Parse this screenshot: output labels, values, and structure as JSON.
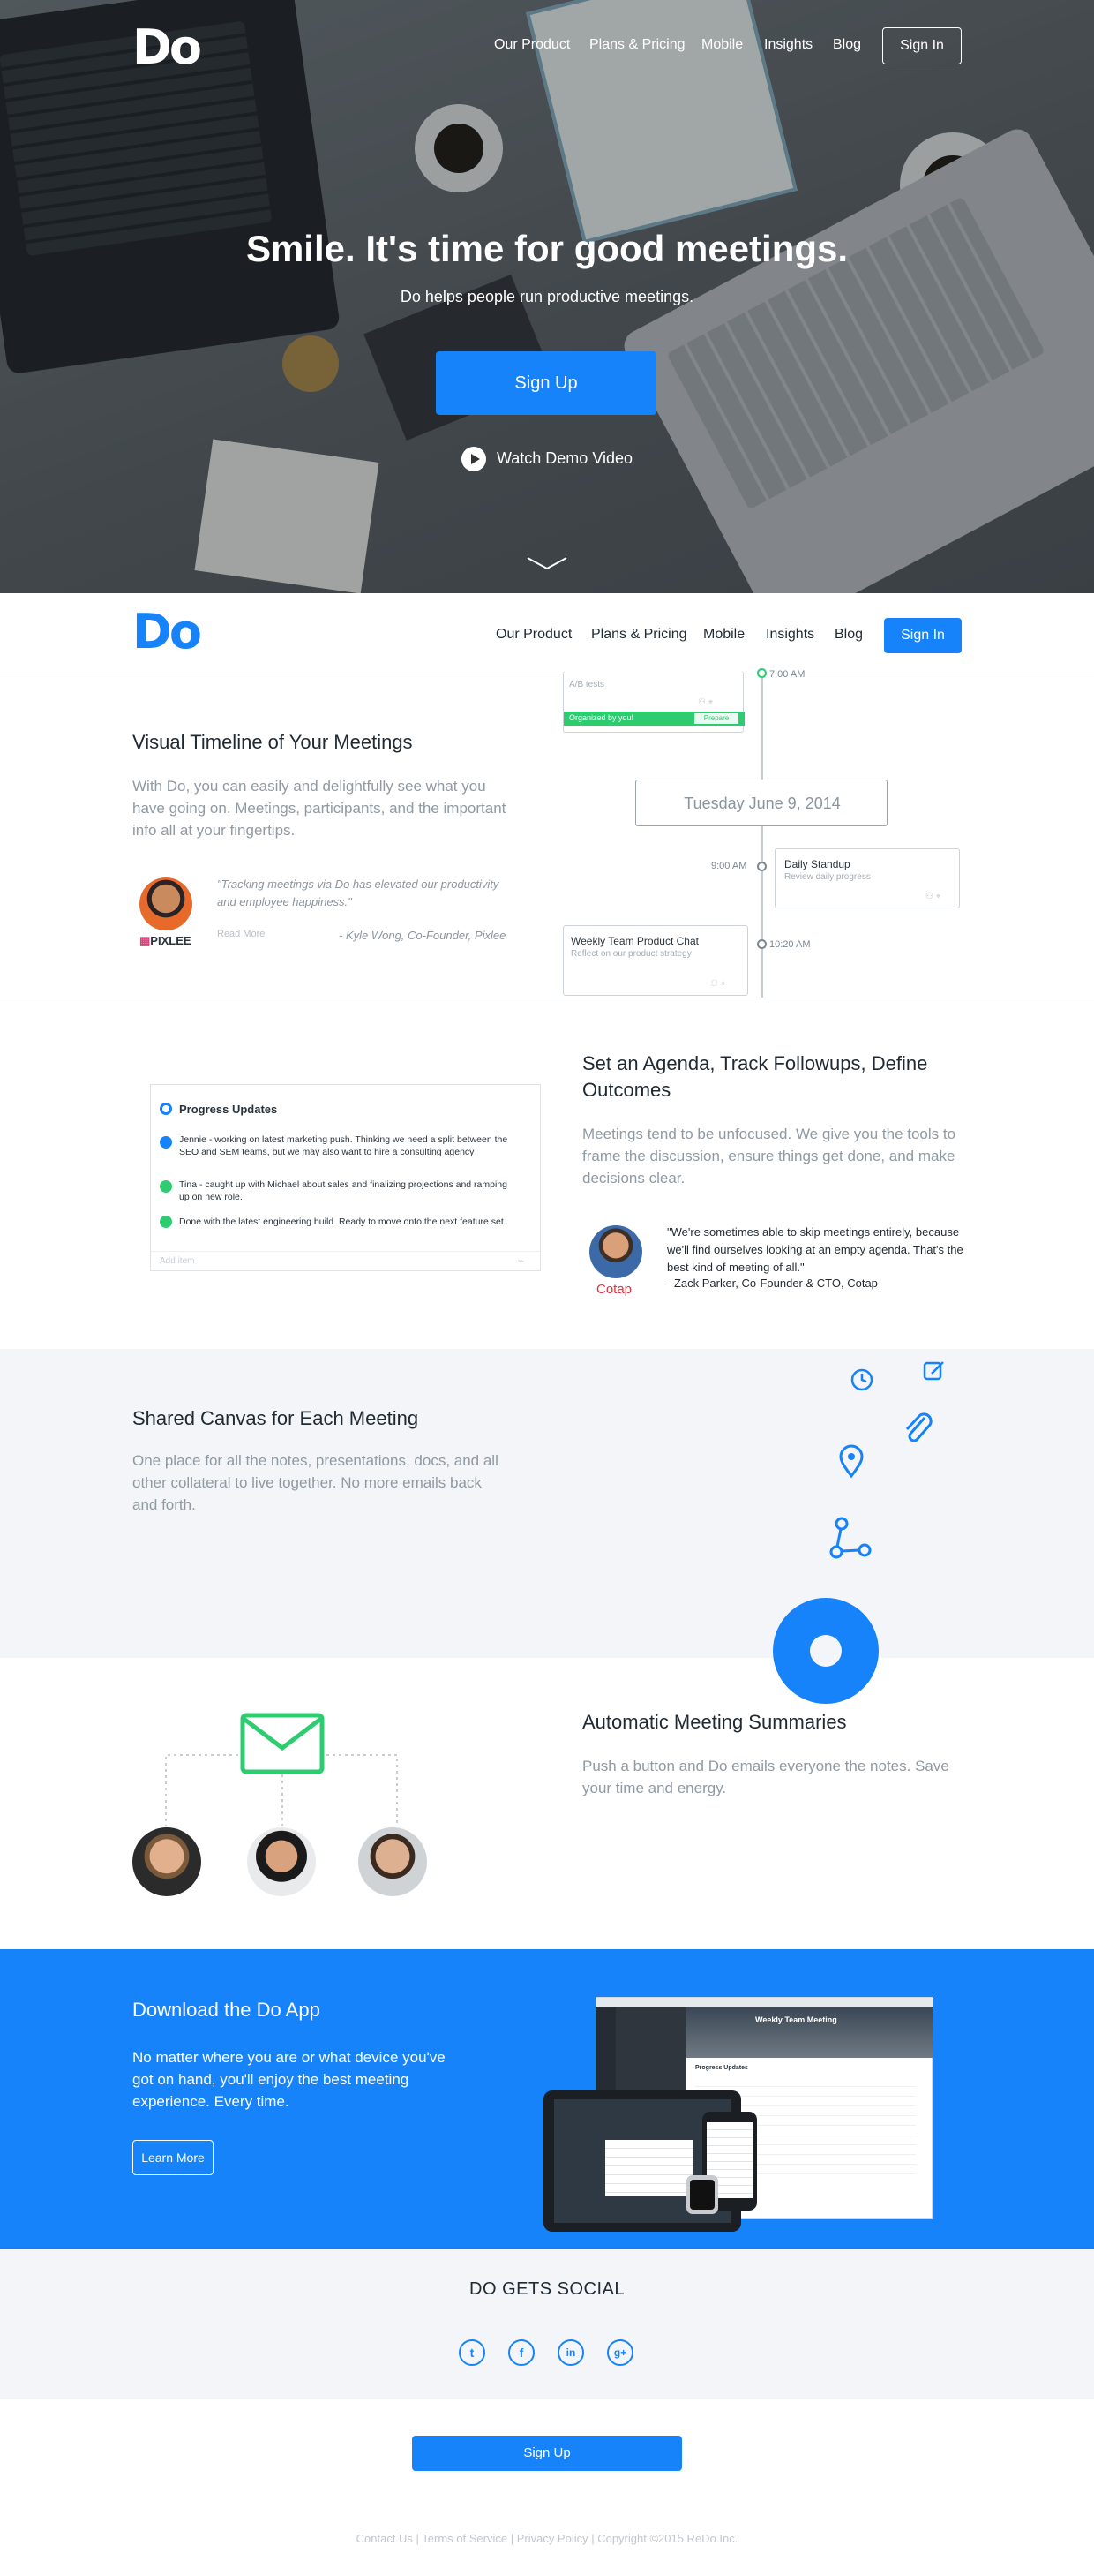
{
  "hero": {
    "logo": "Do",
    "nav": [
      "Our Product",
      "Plans & Pricing",
      "Mobile",
      "Insights",
      "Blog"
    ],
    "signin": "Sign In",
    "title": "Smile. It's time for good meetings.",
    "subtitle": "Do helps people run productive meetings.",
    "signup": "Sign Up",
    "demo": "Watch Demo Video"
  },
  "sticky_nav": {
    "logo": "Do",
    "nav": [
      "Our Product",
      "Plans & Pricing",
      "Mobile",
      "Insights",
      "Blog"
    ],
    "signin": "Sign In"
  },
  "timeline_section": {
    "title": "Visual Timeline of Your Meetings",
    "body": "With Do, you can easily and delightfully see what you have going on. Meetings, participants, and the important info all at your fingertips.",
    "quote": "\"Tracking meetings via Do has elevated our productivity and employee happiness.\"",
    "read_more": "Read More",
    "attribution": "- Kyle Wong, Co-Founder, Pixlee",
    "company_logo": "PIXLEE",
    "top_card_sub": "A/B tests",
    "organized": "Organized by you!",
    "prepare": "Prepare",
    "date": "Tuesday June 9, 2014",
    "time1": "9:00 AM",
    "card1_title": "Daily Standup",
    "card1_sub": "Review daily progress",
    "time2": "10:20 AM",
    "card2_title": "Weekly Team Product Chat",
    "card2_sub": "Reflect on our product strategy",
    "time0": "7:00 AM"
  },
  "agenda_section": {
    "title": "Set an Agenda, Track Followups, Define Outcomes",
    "body": "Meetings tend to be unfocused. We give you the tools to frame the discussion, ensure things get done, and make decisions clear.",
    "quote": "\"We're sometimes able to skip meetings entirely, because we'll find ourselves looking at an empty agenda. That's the best kind of meeting of all.\"",
    "attribution": "- Zack Parker, Co-Founder & CTO, Cotap",
    "company_logo": "Cotap",
    "card_title": "Progress Updates",
    "items": [
      "Jennie - working on latest marketing push. Thinking we need a split between the SEO and SEM teams, but we may also want to hire a consulting agency",
      "Tina - caught up with Michael about sales and finalizing projections and ramping up on new role.",
      "Done with the latest engineering build. Ready to move onto the next feature set."
    ],
    "add_placeholder": "Add item"
  },
  "canvas_section": {
    "title": "Shared Canvas for Each Meeting",
    "body": "One place for all the notes, presentations, docs, and all other collateral to live together. No more emails back and forth."
  },
  "summaries_section": {
    "title": "Automatic Meeting Summaries",
    "body": "Push a button and Do emails everyone the notes. Save your time and energy."
  },
  "download_section": {
    "title": "Download the Do App",
    "body": "No matter where you are or what device you've got on hand, you'll enjoy the best meeting experience. Every time.",
    "button": "Learn More",
    "app_meeting_title": "Weekly Team Meeting",
    "app_section": "Progress Updates"
  },
  "social_section": {
    "title": "DO GETS SOCIAL",
    "icons": [
      "twitter-icon",
      "facebook-icon",
      "linkedin-icon",
      "googleplus-icon"
    ]
  },
  "footer": {
    "signup": "Sign Up",
    "links": "Contact Us | Terms of Service | Privacy Policy | Copyright ©2015 ReDo Inc."
  },
  "colors": {
    "brand_blue": "#1683fb",
    "green": "#2ecc71",
    "text_dark": "#1f2a33",
    "text_muted": "#8f9aa3"
  }
}
